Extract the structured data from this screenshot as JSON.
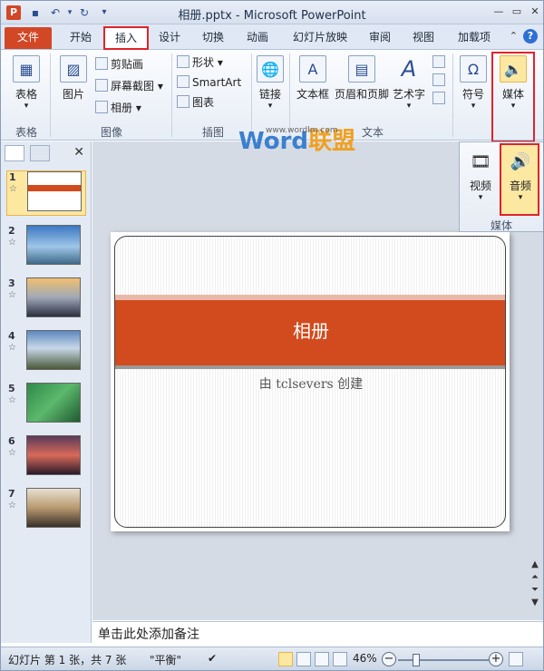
{
  "titlebar": {
    "title": "相册.pptx - Microsoft PowerPoint",
    "app_logo": "P"
  },
  "tabs": [
    {
      "label": "文件"
    },
    {
      "label": "开始"
    },
    {
      "label": "插入"
    },
    {
      "label": "设计"
    },
    {
      "label": "切换"
    },
    {
      "label": "动画"
    },
    {
      "label": "幻灯片放映"
    },
    {
      "label": "审阅"
    },
    {
      "label": "视图"
    },
    {
      "label": "加载项"
    }
  ],
  "ribbon": {
    "groups": {
      "table": "表格",
      "images": "图像",
      "illustrations": "插图",
      "text": "文本"
    },
    "buttons": {
      "table": "表格",
      "picture": "图片",
      "clipart": "剪贴画",
      "screenshot": "屏幕截图",
      "album": "相册",
      "shapes": "形状",
      "smartart": "SmartArt",
      "chart": "图表",
      "link": "链接",
      "textbox": "文本框",
      "header_footer": "页眉和页脚",
      "wordart": "艺术字",
      "symbol": "符号",
      "media": "媒体"
    }
  },
  "media_dropdown": {
    "video": "视频",
    "audio": "音频",
    "group_label": "媒体"
  },
  "slides": [
    {
      "num": "1",
      "star": "☆"
    },
    {
      "num": "2",
      "star": "☆"
    },
    {
      "num": "3",
      "star": "☆"
    },
    {
      "num": "4",
      "star": "☆"
    },
    {
      "num": "5",
      "star": "☆"
    },
    {
      "num": "6",
      "star": "☆"
    },
    {
      "num": "7",
      "star": "☆"
    }
  ],
  "slide_content": {
    "title": "相册",
    "subtitle": "由 tclsevers 创建"
  },
  "watermark": {
    "word": "Word",
    "cn": "联盟",
    "url": "www.wordlm.com"
  },
  "notes": {
    "placeholder": "单击此处添加备注"
  },
  "status": {
    "slide_info": "幻灯片 第 1 张，共 7 张",
    "theme": "\"平衡\"",
    "zoom": "46%",
    "zoom_level": 0.46
  },
  "colors": {
    "accent": "#d24726",
    "highlight": "#e0232c",
    "band": "#d14b1e"
  }
}
